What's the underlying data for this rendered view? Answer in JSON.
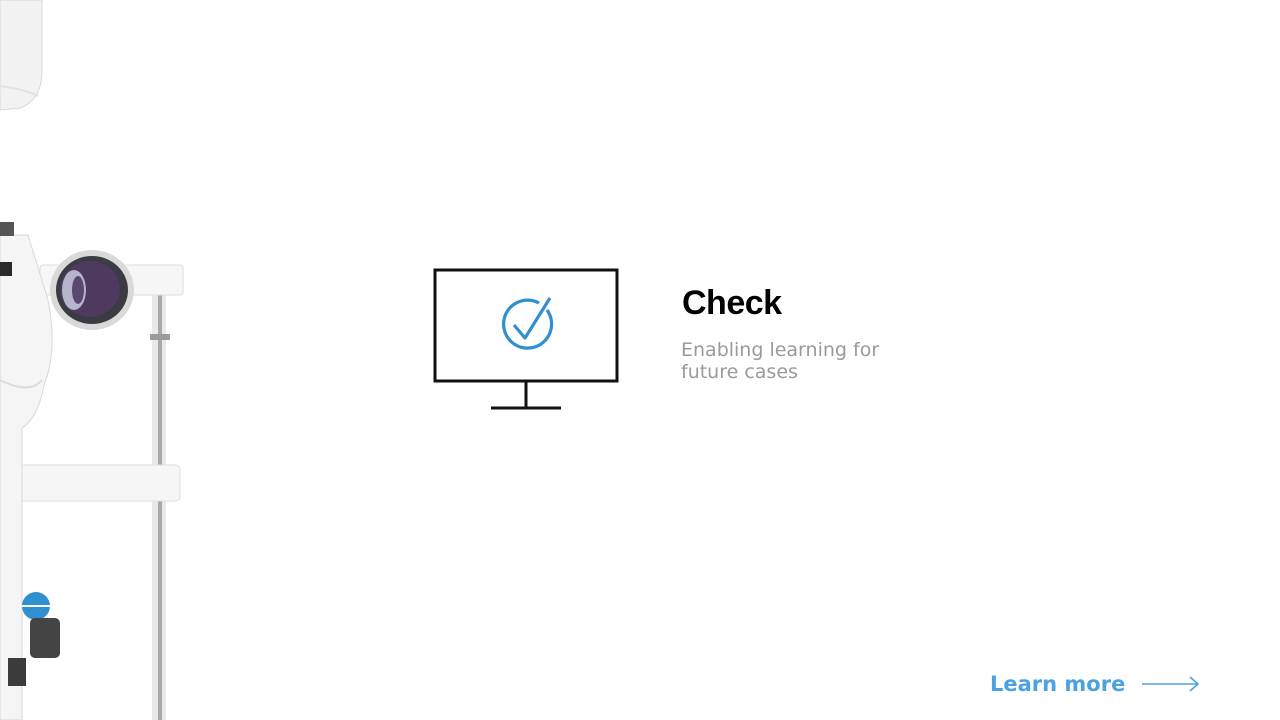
{
  "feature": {
    "title": "Check",
    "description": "Enabling learning for future cases"
  },
  "cta": {
    "label": "Learn more"
  },
  "icons": {
    "main": "monitor-check-icon",
    "cta": "arrow-right-icon"
  },
  "colors": {
    "accent": "#2f8fcf",
    "link": "#4aa3e0",
    "title": "#000000",
    "description": "#9a9a9a",
    "background": "#ffffff"
  }
}
